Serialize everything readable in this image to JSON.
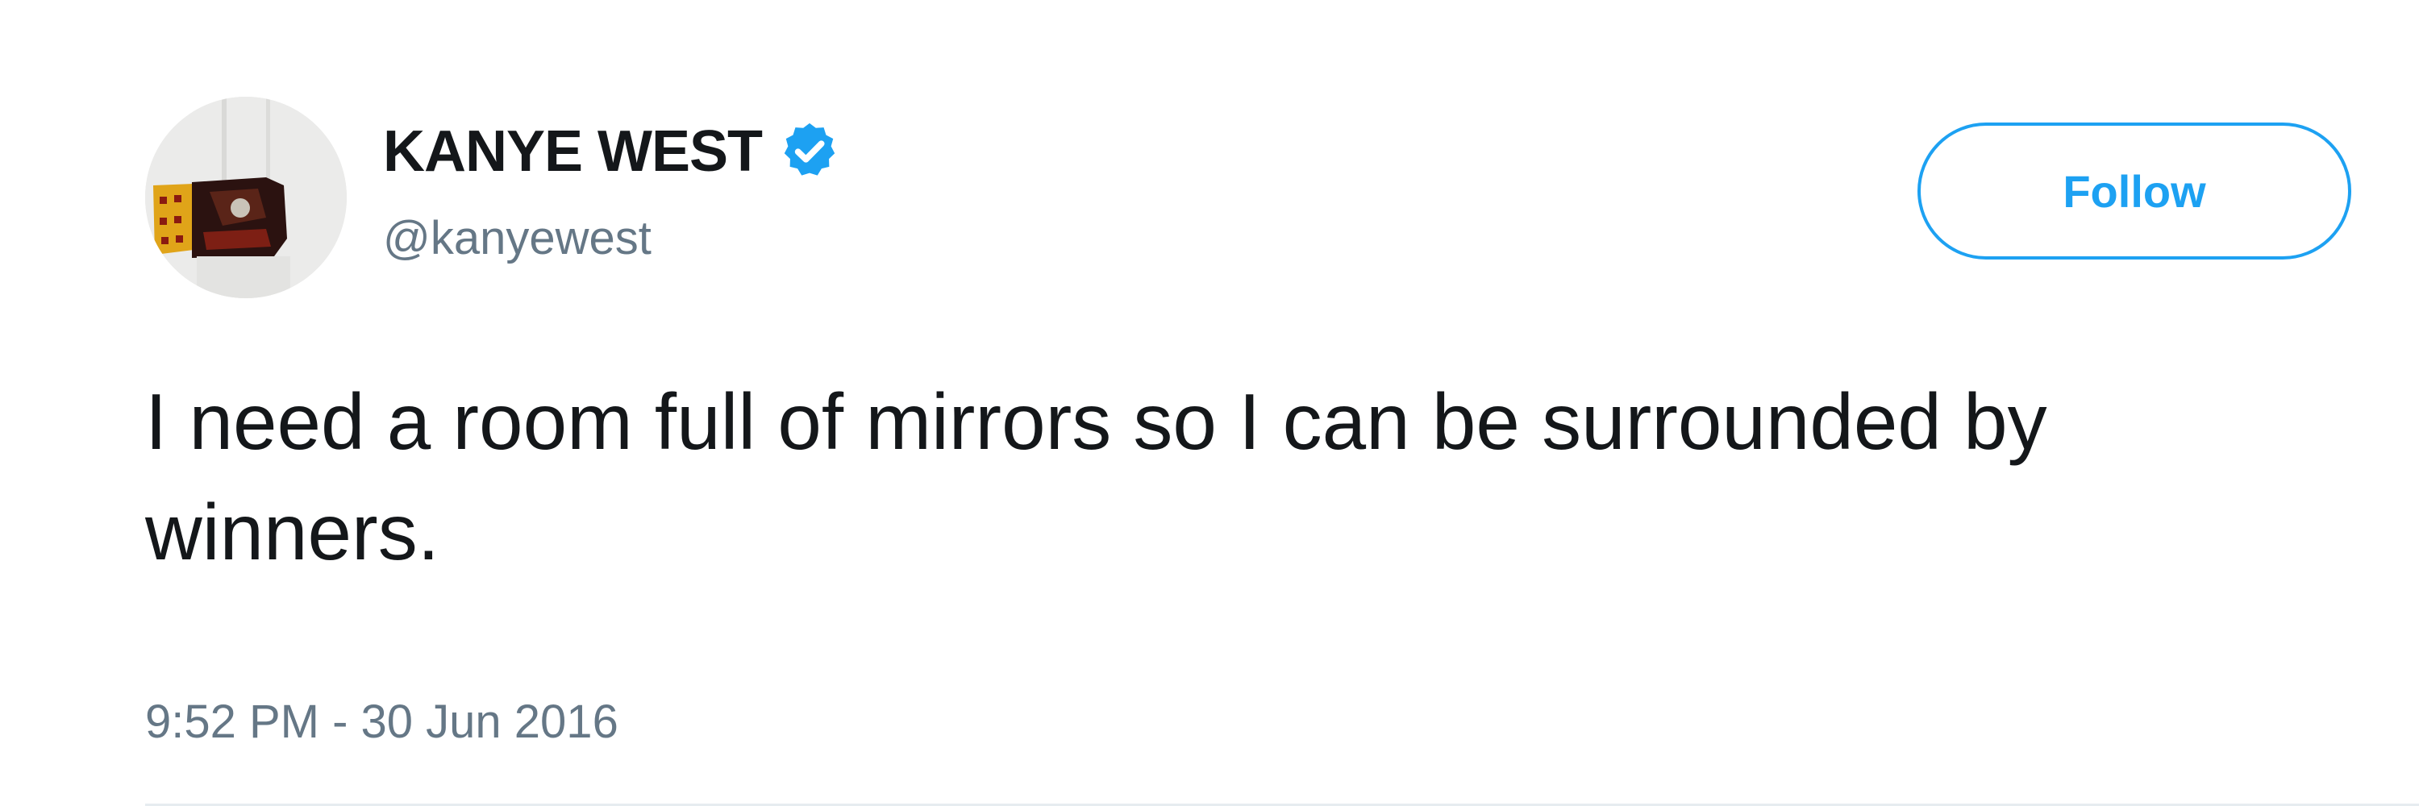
{
  "user": {
    "display_name": "KANYE WEST",
    "screen_name": "@kanyewest",
    "verified_icon": "verified-badge-icon",
    "avatar_icon": "profile-avatar"
  },
  "follow_button": {
    "label": "Follow"
  },
  "tweet": {
    "text": "I need a room full of mirrors so I can be surrounded by winners.",
    "timestamp": "9:52 PM - 30 Jun 2016"
  },
  "colors": {
    "accent": "#1da1f2",
    "text": "#14171a",
    "secondary_text": "#657786"
  }
}
